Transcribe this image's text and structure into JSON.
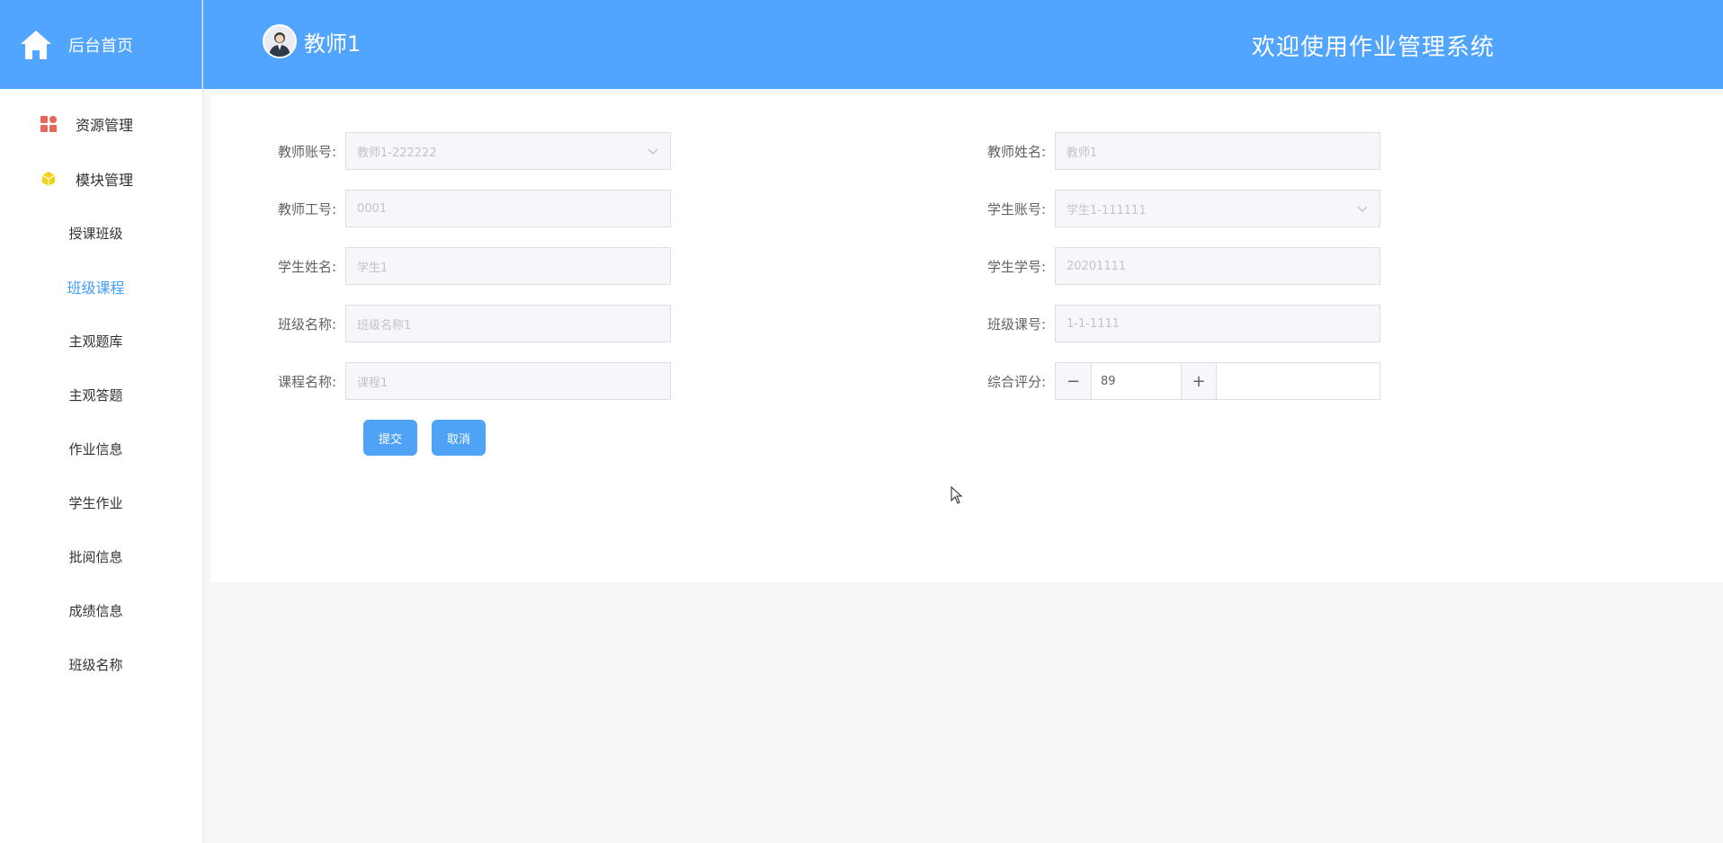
{
  "sidebar": {
    "brand_label": "后台首页",
    "groups": [
      {
        "label": "资源管理",
        "icon": "grid-icon",
        "color": "#e8655a"
      },
      {
        "label": "模块管理",
        "icon": "cube-icon",
        "color": "#f5d116"
      }
    ],
    "items": [
      {
        "label": "授课班级"
      },
      {
        "label": "班级课程",
        "active": true
      },
      {
        "label": "主观题库"
      },
      {
        "label": "主观答题"
      },
      {
        "label": "作业信息"
      },
      {
        "label": "学生作业"
      },
      {
        "label": "批阅信息"
      },
      {
        "label": "成绩信息"
      },
      {
        "label": "班级名称"
      }
    ]
  },
  "header": {
    "user_name": "教师1",
    "system_title": "欢迎使用作业管理系统"
  },
  "form": {
    "teacher_account": {
      "label": "教师账号:",
      "value": "教师1-222222"
    },
    "teacher_name": {
      "label": "教师姓名:",
      "value": "教师1"
    },
    "teacher_id": {
      "label": "教师工号:",
      "value": "0001"
    },
    "student_account": {
      "label": "学生账号:",
      "value": "学生1-111111"
    },
    "student_name": {
      "label": "学生姓名:",
      "value": "学生1"
    },
    "student_no": {
      "label": "学生学号:",
      "value": "20201111"
    },
    "class_name": {
      "label": "班级名称:",
      "value": "班级名称1"
    },
    "class_course_no": {
      "label": "班级课号:",
      "value": "1-1-1111"
    },
    "course_name": {
      "label": "课程名称:",
      "value": "课程1"
    },
    "score": {
      "label": "综合评分:",
      "value": "89",
      "minus": "−",
      "plus": "+"
    },
    "submit_label": "提交",
    "cancel_label": "取消"
  },
  "colors": {
    "primary": "#51a5ff",
    "button": "#4fa3f7",
    "active_menu": "#409eff"
  }
}
